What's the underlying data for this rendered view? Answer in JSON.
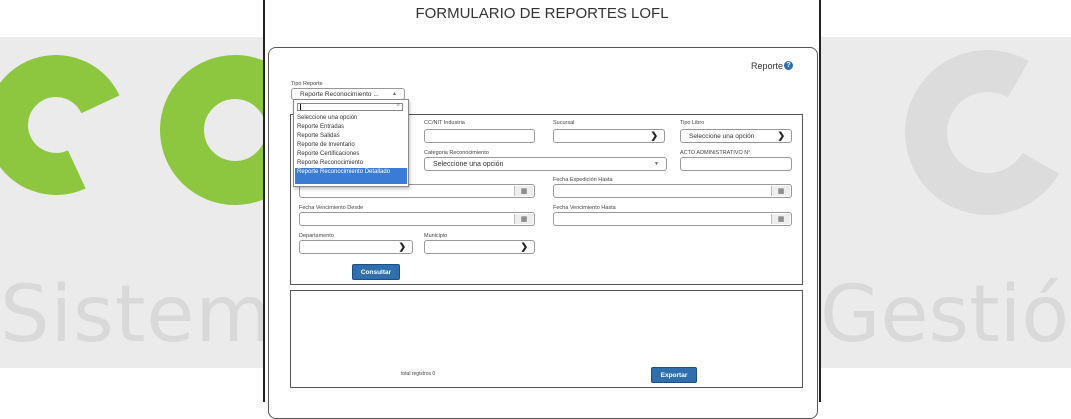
{
  "watermark": {
    "left_text": "Sistema",
    "right_text": "Gestión"
  },
  "page": {
    "title": "FORMULARIO DE REPORTES LOFL"
  },
  "header": {
    "reporte_label": "Reporte",
    "help_glyph": "?"
  },
  "tipo_reporte": {
    "label": "Tipo Reporte",
    "selected": "Reporte Reconocimiento ...",
    "options": [
      "Seleccione una opción",
      "Reporte Entradas",
      "Reporte Salidas",
      "Reporte de Inventario",
      "Reporte Certificaciones",
      "Reporte Reconocimiento",
      "Reporte Reconocimiento Detallado"
    ]
  },
  "filters": {
    "ccnit_label": "CC/NIT Industria",
    "sucursal_label": "Sucursal",
    "tipo_libro_label": "Tipo Libro",
    "tipo_libro_value": "Seleccione una opción",
    "categoria_label": "Categoria Reconocimiento",
    "categoria_value": "Seleccione una opción",
    "acto_label": "ACTO ADMINISTRATIVO N°",
    "fecha_exp_hasta_label": "Fecha Expedición Hasta",
    "fecha_venc_desde_label": "Fecha Vencimiento Desde",
    "fecha_venc_hasta_label": "Fecha Vencimiento Hasta",
    "departamento_label": "Departamento",
    "municipio_label": "Municipio",
    "consultar_label": "Consultar"
  },
  "results": {
    "total_text": "total registros 0",
    "exportar_label": "Exportar"
  },
  "icons": {
    "chevron": "chevron-down-icon",
    "calendar": "calendar-icon",
    "search": "search-icon",
    "help": "help-circle-icon"
  }
}
